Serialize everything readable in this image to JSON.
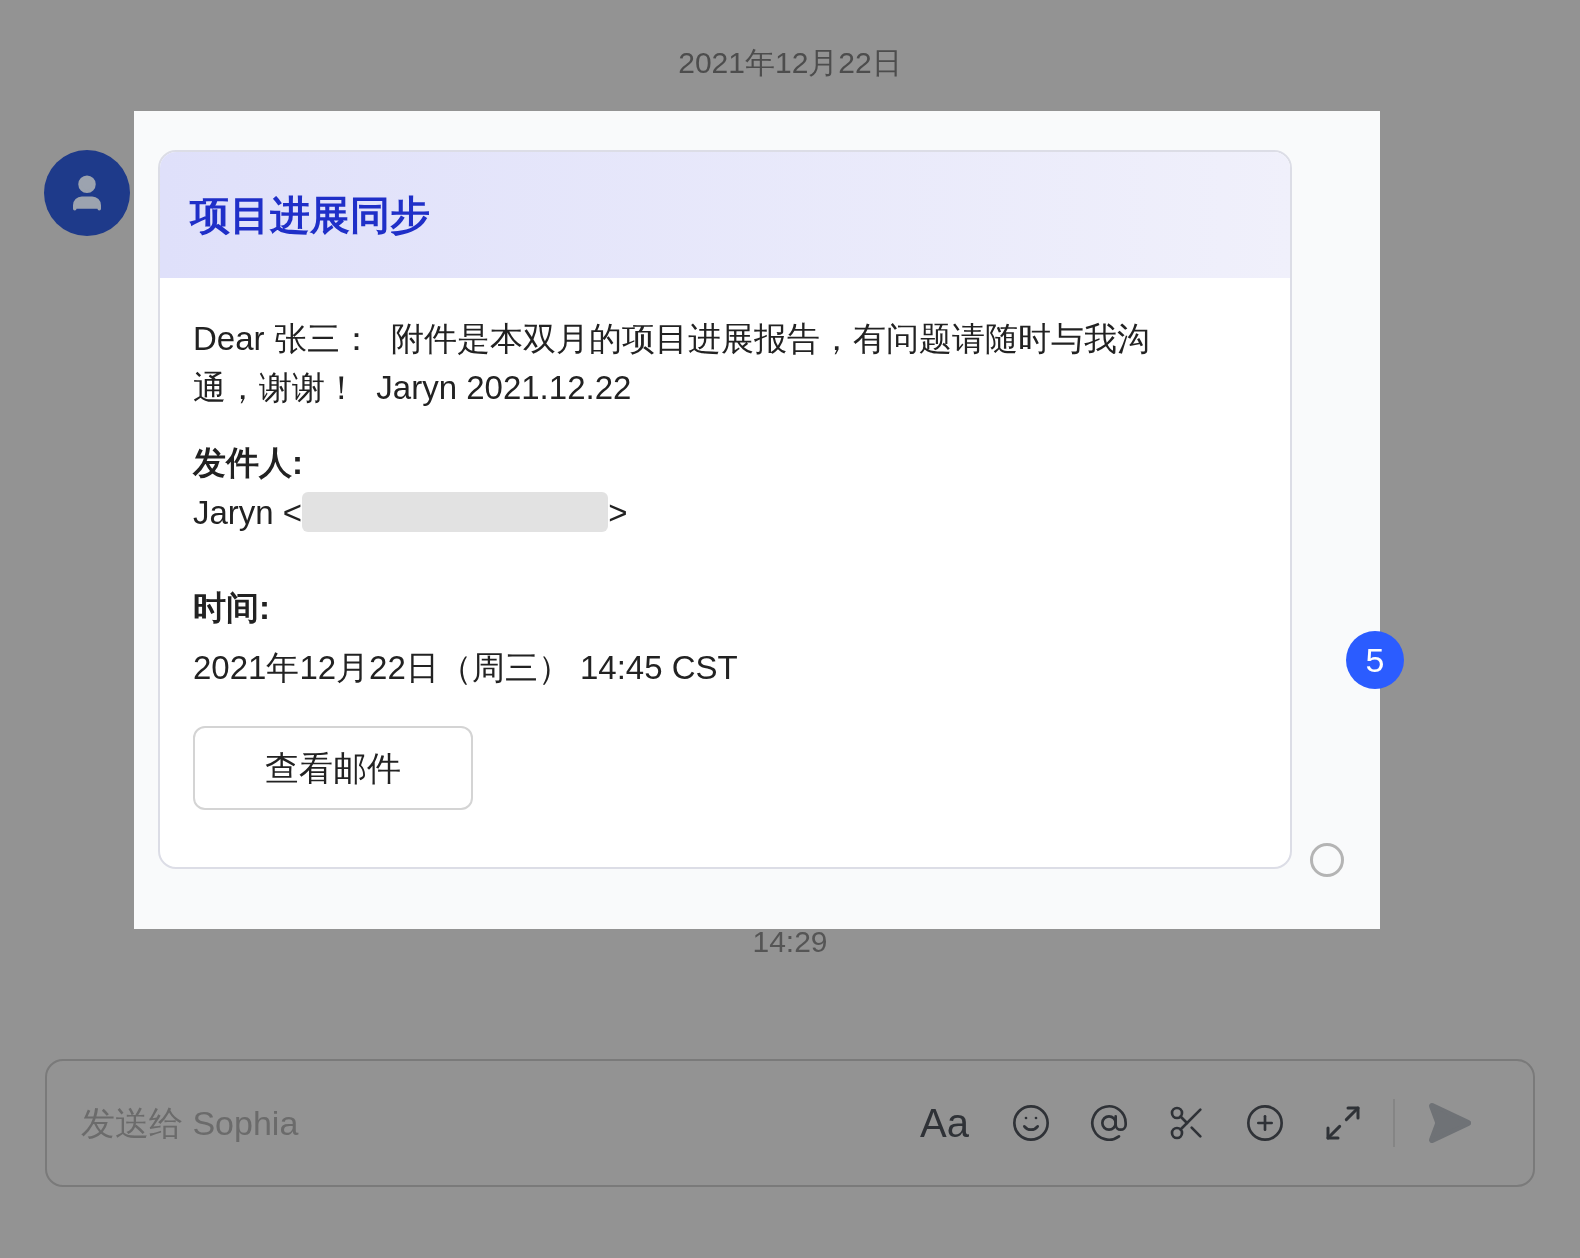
{
  "date_divider": "2021年12月22日",
  "message": {
    "card": {
      "title": "项目进展同步",
      "body": "Dear 张三：  附件是本双月的项目进展报告，有问题请随时与我沟通，谢谢！  Jaryn 2021.12.22",
      "sender_label": "发件人:",
      "sender_prefix": "Jaryn <",
      "sender_suffix": ">",
      "time_label": "时间:",
      "time_value": "2021年12月22日（周三） 14:45 CST",
      "button": "查看邮件"
    },
    "read": false,
    "time": "14:29"
  },
  "step_badge": "5",
  "composer": {
    "placeholder": "发送给 Sophia",
    "tools": [
      {
        "kind": "format",
        "label": "Aa"
      },
      {
        "kind": "emoji"
      },
      {
        "kind": "mention"
      },
      {
        "kind": "screenshot"
      },
      {
        "kind": "more"
      },
      {
        "kind": "expand"
      }
    ]
  }
}
